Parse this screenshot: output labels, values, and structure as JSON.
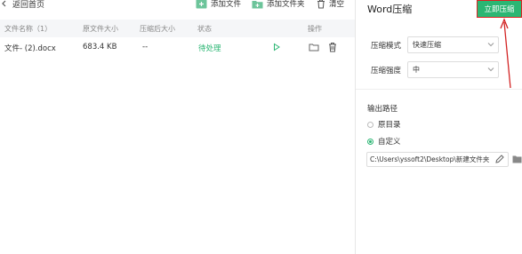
{
  "header": {
    "back_label": "返回首页",
    "add_file_label": "添加文件",
    "add_folder_label": "添加文件夹",
    "clear_label": "清空"
  },
  "table": {
    "columns": {
      "name": "文件名称（1）",
      "original_size": "原文件大小",
      "compressed_size": "压缩后大小",
      "status": "状态",
      "actions": "操作"
    },
    "rows": [
      {
        "name": "文件- (2).docx",
        "original_size": "683.4 KB",
        "compressed_size": "--",
        "status": "待处理"
      }
    ]
  },
  "settings": {
    "title": "Word压缩",
    "start_button": "立即压缩",
    "mode_label": "压缩模式",
    "mode_value": "快速压缩",
    "strength_label": "压缩强度",
    "strength_value": "中",
    "output_label": "输出路径",
    "option_original": "原目录",
    "option_custom": "自定义",
    "selected_option": "自定义",
    "path_value": "C:\\Users\\yssoft2\\Desktop\\新建文件夹"
  },
  "colors": {
    "accent": "#2bb673",
    "annotation": "#d22222",
    "header_bg": "#f5f6f8"
  }
}
